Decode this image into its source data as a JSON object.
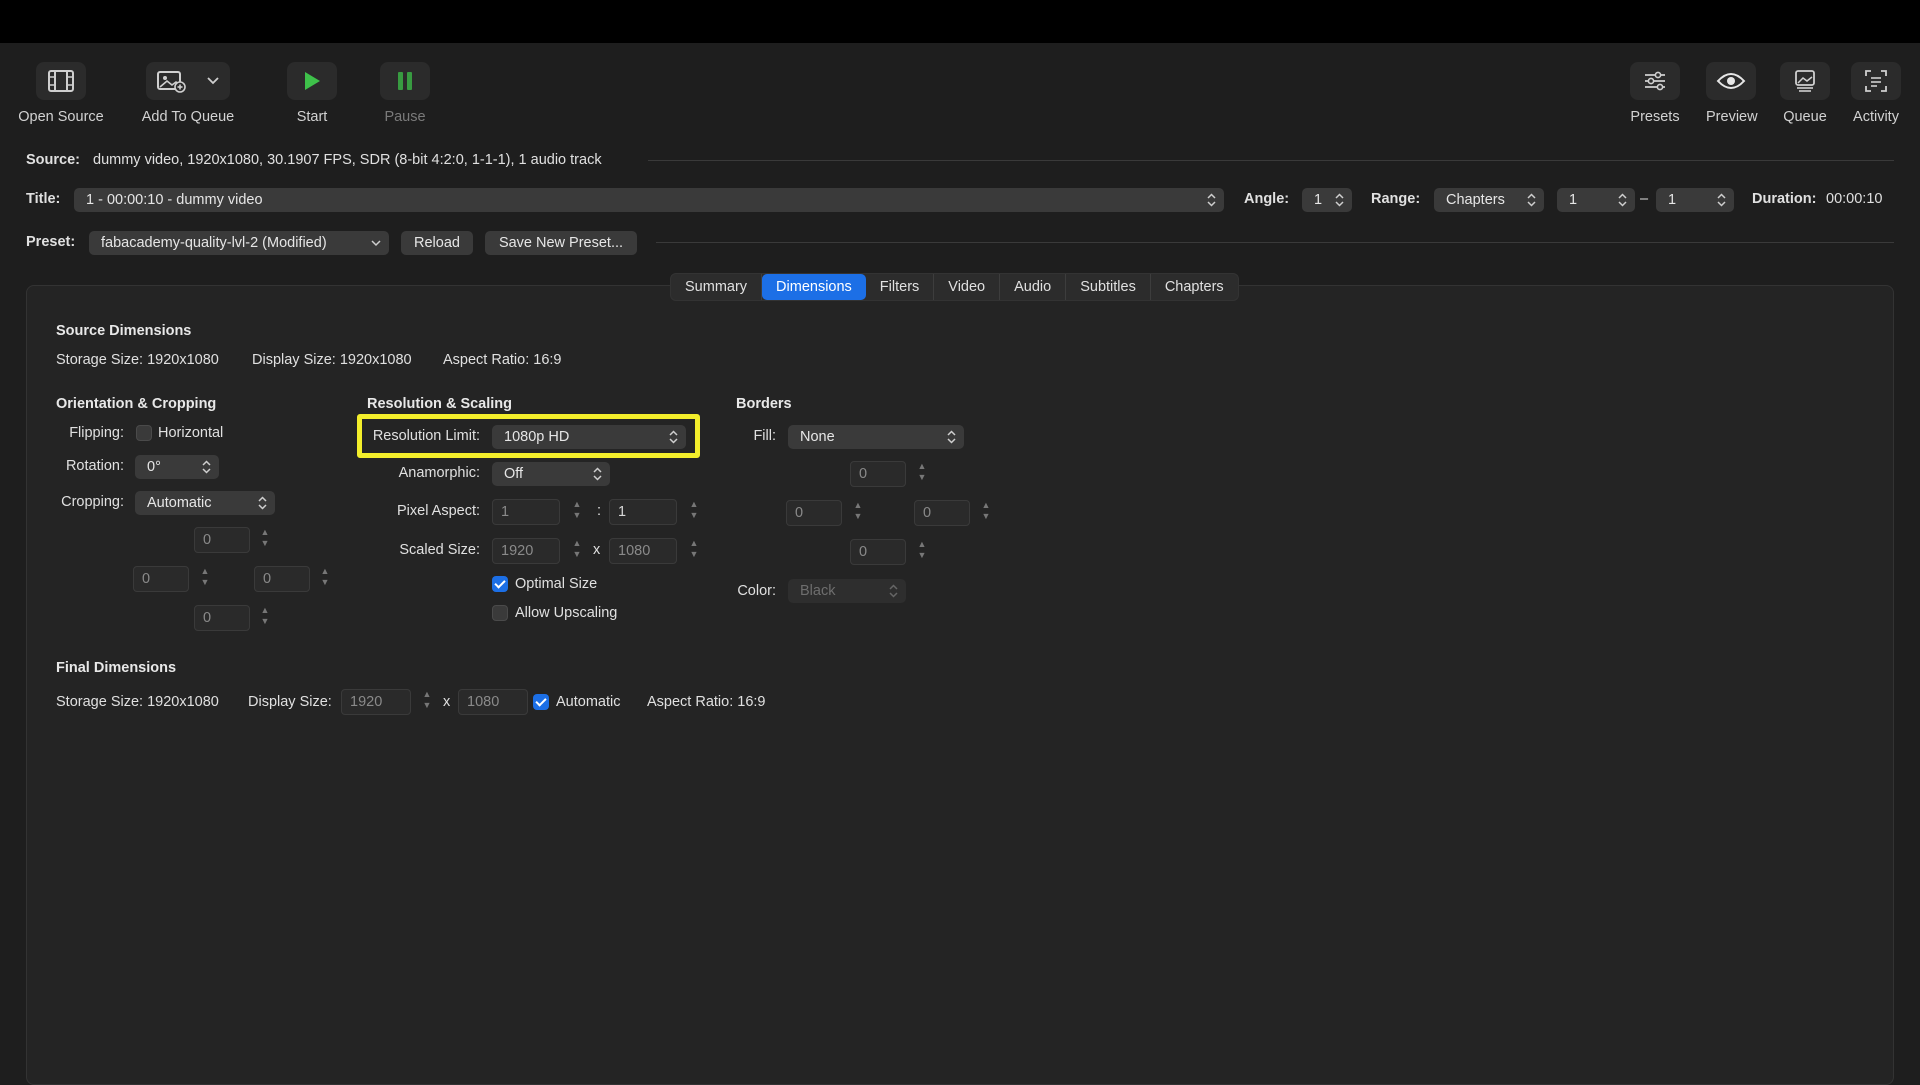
{
  "toolbar": {
    "open_source": "Open Source",
    "add_to_queue": "Add To Queue",
    "start": "Start",
    "pause": "Pause",
    "presets": "Presets",
    "preview": "Preview",
    "queue": "Queue",
    "activity": "Activity"
  },
  "source": {
    "label": "Source:",
    "value": "dummy video, 1920x1080, 30.1907 FPS, SDR (8-bit 4:2:0, 1-1-1), 1 audio track"
  },
  "title_row": {
    "label": "Title:",
    "value": "1 - 00:00:10 - dummy video",
    "angle_label": "Angle:",
    "angle_value": "1",
    "range_label": "Range:",
    "range_value": "Chapters",
    "range_start": "1",
    "range_dash": "–",
    "range_end": "1",
    "duration_label": "Duration:",
    "duration_value": "00:00:10"
  },
  "preset_row": {
    "label": "Preset:",
    "value": "fabacademy-quality-lvl-2 (Modified)",
    "reload": "Reload",
    "save_new": "Save New Preset..."
  },
  "tabs": [
    "Summary",
    "Dimensions",
    "Filters",
    "Video",
    "Audio",
    "Subtitles",
    "Chapters"
  ],
  "active_tab": "Dimensions",
  "source_dimensions": {
    "title": "Source Dimensions",
    "storage_size": "Storage Size: 1920x1080",
    "display_size": "Display Size: 1920x1080",
    "aspect_ratio": "Aspect Ratio:  16:9"
  },
  "orientation": {
    "title": "Orientation & Cropping",
    "flipping_label": "Flipping:",
    "horizontal": "Horizontal",
    "rotation_label": "Rotation:",
    "rotation_value": "0°",
    "cropping_label": "Cropping:",
    "cropping_value": "Automatic",
    "crop_top": "0",
    "crop_left": "0",
    "crop_right": "0",
    "crop_bottom": "0"
  },
  "resolution": {
    "title": "Resolution & Scaling",
    "limit_label": "Resolution Limit:",
    "limit_value": "1080p HD",
    "anamorphic_label": "Anamorphic:",
    "anamorphic_value": "Off",
    "pixel_aspect_label": "Pixel Aspect:",
    "pixel_aspect_w": "1",
    "pixel_aspect_sep": ":",
    "pixel_aspect_h": "1",
    "scaled_size_label": "Scaled Size:",
    "scaled_w": "1920",
    "scaled_sep": "x",
    "scaled_h": "1080",
    "optimal_size": "Optimal Size",
    "allow_upscaling": "Allow Upscaling"
  },
  "borders": {
    "title": "Borders",
    "fill_label": "Fill:",
    "fill_value": "None",
    "top": "0",
    "left": "0",
    "right": "0",
    "bottom": "0",
    "color_label": "Color:",
    "color_value": "Black"
  },
  "final_dimensions": {
    "title": "Final Dimensions",
    "storage_size": "Storage Size: 1920x1080",
    "display_size_label": "Display Size:",
    "display_w": "1920",
    "display_sep": "x",
    "display_h": "1080",
    "automatic": "Automatic",
    "aspect_ratio": "Aspect Ratio:  16:9"
  },
  "colors": {
    "accent": "#1c6fe6",
    "highlight": "#f3ee2b",
    "start_green": "#3ec14a"
  }
}
